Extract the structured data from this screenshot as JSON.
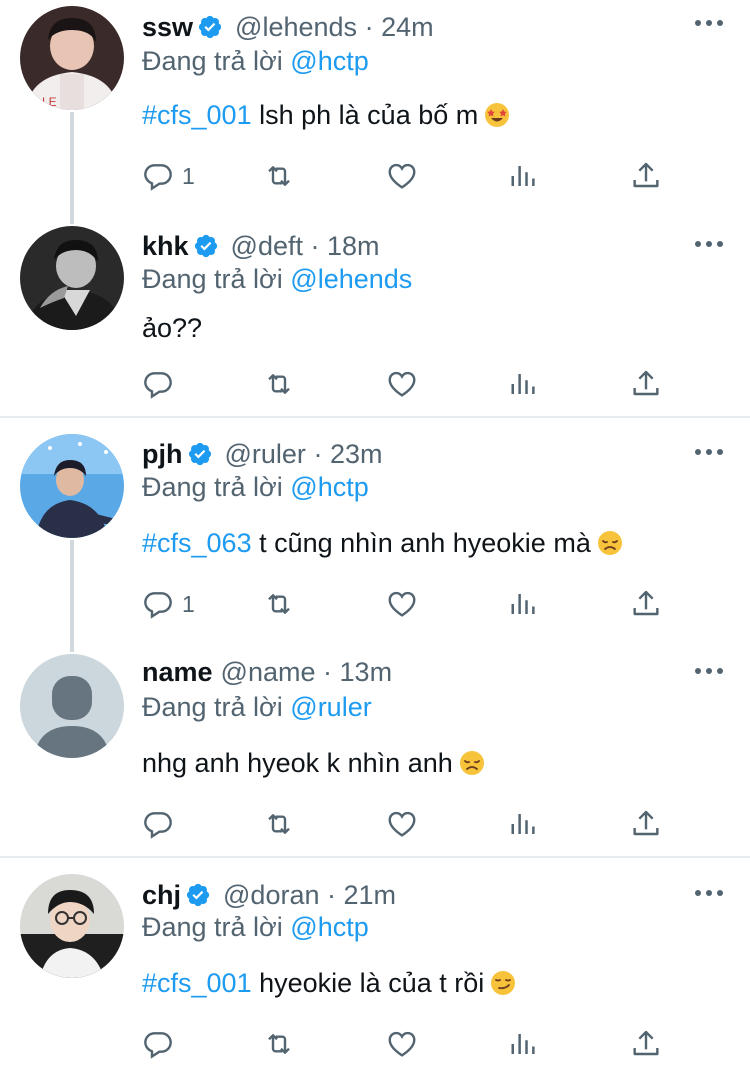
{
  "colors": {
    "accent": "#1d9bf0",
    "secondary_text": "#536471",
    "primary_text": "#0f1419",
    "divider": "#e6ecf0"
  },
  "tweets": [
    {
      "name": "ssw",
      "verified": true,
      "handle": "@lehends",
      "separator": "·",
      "time": "24m",
      "reply_prefix": "Đang trả lời",
      "reply_mention": "@hctp",
      "hashtag": "#cfs_001",
      "body": "lsh ph là của bố m",
      "emoji": "star-struck",
      "reply_count": "1",
      "avatar": "photo-white-jacket"
    },
    {
      "name": "khk",
      "verified": true,
      "handle": "@deft",
      "separator": "·",
      "time": "18m",
      "reply_prefix": "Đang trả lời",
      "reply_mention": "@lehends",
      "hashtag": "",
      "body": "ảo??",
      "emoji": "",
      "reply_count": "",
      "avatar": "photo-grayscale"
    },
    {
      "name": "pjh",
      "verified": true,
      "handle": "@ruler",
      "separator": "·",
      "time": "23m",
      "reply_prefix": "Đang trả lời",
      "reply_mention": "@hctp",
      "hashtag": "#cfs_063",
      "body": "t cũng nhìn anh hyeokie mà",
      "emoji": "disappointed",
      "reply_count": "1",
      "avatar": "photo-blue-stage"
    },
    {
      "name": "name",
      "verified": false,
      "handle": "@name",
      "separator": "·",
      "time": "13m",
      "reply_prefix": "Đang trả lời",
      "reply_mention": "@ruler",
      "hashtag": "",
      "body": "nhg anh hyeok k nhìn anh",
      "emoji": "disappointed",
      "reply_count": "",
      "avatar": "default-avatar"
    },
    {
      "name": "chj",
      "verified": true,
      "handle": "@doran",
      "separator": "·",
      "time": "21m",
      "reply_prefix": "Đang trả lời",
      "reply_mention": "@hctp",
      "hashtag": "#cfs_001",
      "body": "hyeokie là của t rồi",
      "emoji": "smirk",
      "reply_count": "",
      "avatar": "photo-glasses"
    }
  ]
}
